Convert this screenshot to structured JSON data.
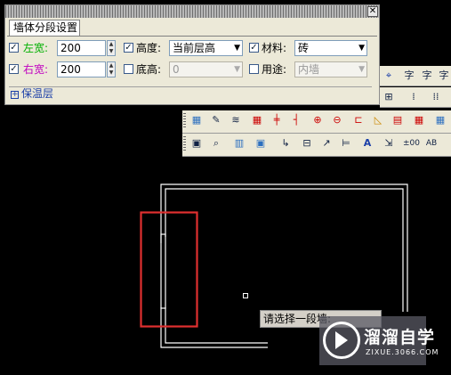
{
  "dialog": {
    "title": "墙体分段设置",
    "close_glyph": "✕",
    "row1": {
      "left_width_label": "左宽:",
      "left_width_value": "200",
      "left_width_checked": true,
      "height_label": "高度:",
      "height_checked": true,
      "height_value": "当前层高",
      "material_label": "材料:",
      "material_checked": true,
      "material_value": "砖"
    },
    "row2": {
      "right_width_label": "右宽:",
      "right_width_value": "200",
      "right_width_checked": true,
      "base_height_label": "底高:",
      "base_height_checked": false,
      "base_height_value": "0",
      "usage_label": "用途:",
      "usage_checked": false,
      "usage_value": "内墙"
    },
    "insulation_expand": "+",
    "insulation_label": "保温层"
  },
  "colors": {
    "left_label": "#00c000",
    "right_label": "#c000c0",
    "highlight_box": "#e03030",
    "wall_line": "#ffffff"
  },
  "toolbars": {
    "row1_icons": [
      "target-icon",
      "text-icon",
      "text-icon",
      "text-icon"
    ],
    "row1_glyphs": [
      "⌖",
      "字",
      "字",
      "字"
    ],
    "row2_glyphs": [
      "⊞",
      "⁞",
      "⁞⁞"
    ],
    "row3_glyphs": [
      "▦",
      "✎",
      "≋",
      "▦",
      "╪",
      "┤",
      "⊕",
      "⊖",
      "⊏",
      "◺",
      "▤",
      "▦",
      "▦"
    ],
    "row4_glyphs": [
      "▣",
      "⌕",
      "▥",
      "▣",
      "↳",
      "⊟",
      "↗",
      "⊨",
      "A",
      "⇲",
      "±",
      "AB"
    ],
    "row4_text": [
      "±00",
      "AB"
    ]
  },
  "canvas": {
    "tooltip": "请选择一段墙:",
    "watermark_title": "溜溜自学",
    "watermark_url": "ZIXUE.3066.COM"
  }
}
